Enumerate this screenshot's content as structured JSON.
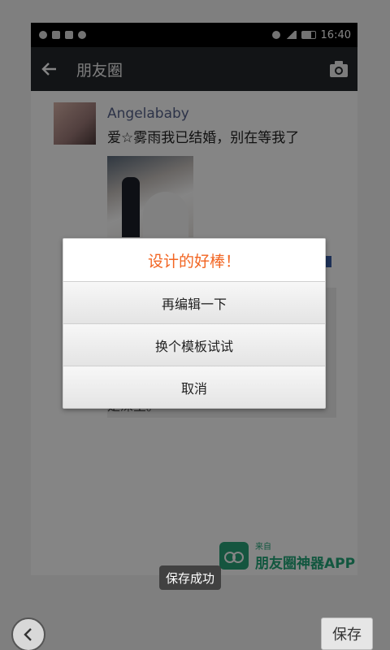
{
  "statusbar": {
    "time": "16:40"
  },
  "titlebar": {
    "title": "朋友圈"
  },
  "post": {
    "name": "Angelababy",
    "text": "爱☆雾雨我已结婚，别在等我了",
    "comment_tail": "是深呈。"
  },
  "watermark": {
    "small": "来自",
    "big": "朋友圈神器APP"
  },
  "dialog": {
    "title": "设计的好棒！",
    "options": [
      "再编辑一下",
      "换个模板试试",
      "取消"
    ]
  },
  "toast": "保存成功",
  "bottom": {
    "save_label": "保存"
  },
  "colors": {
    "dialog_title": "#f26522",
    "watermark": "#23a77a",
    "titlebar": "#23272b"
  }
}
